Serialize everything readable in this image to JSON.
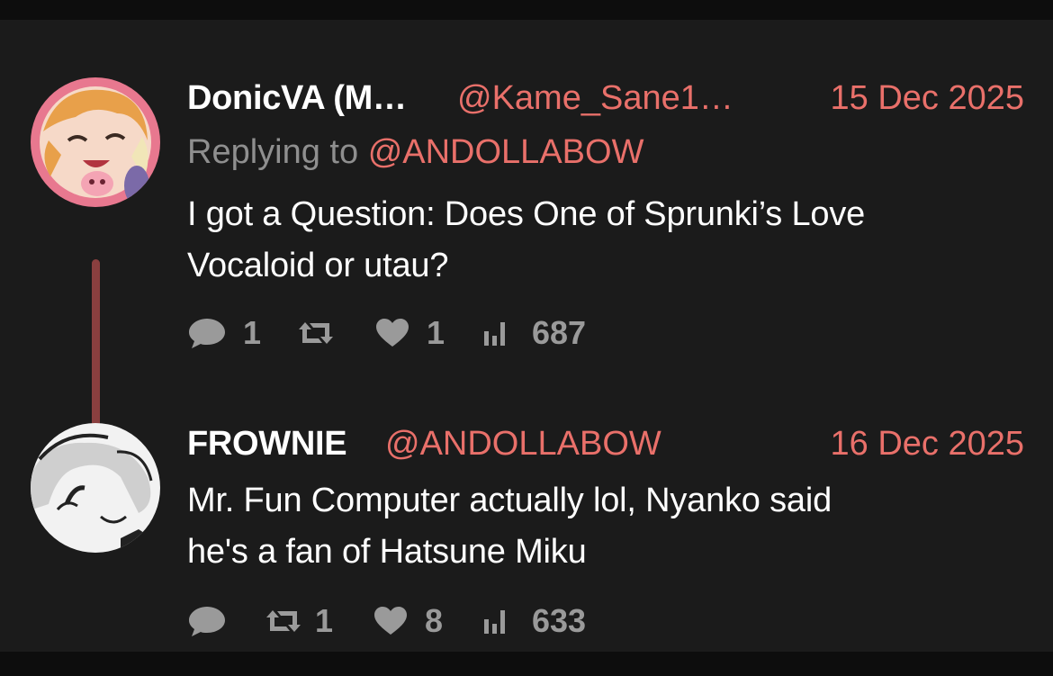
{
  "tweets": [
    {
      "name": "DonicVA (M…",
      "handle": "@Kame_Sane1…",
      "date": "15 Dec 2025",
      "replying_label": "Replying to",
      "replying_handle": "@ANDOLLABOW",
      "text_lines": [
        "I got a Question: Does One of Sprunki’s Love",
        "Vocaloid or utau?"
      ],
      "actions": {
        "replies": "1",
        "retweets": "",
        "likes": "1",
        "views": "687"
      },
      "avatar_icon": "anime-character-avatar"
    },
    {
      "name": "FROWNIE",
      "handle": "@ANDOLLABOW",
      "date": "16 Dec 2025",
      "text_lines": [
        "Mr. Fun Computer actually lol, Nyanko said",
        "he's a fan of Hatsune Miku"
      ],
      "actions": {
        "replies": "",
        "retweets": "1",
        "likes": "8",
        "views": "633"
      },
      "avatar_icon": "sketch-character-avatar"
    }
  ],
  "icons": {
    "reply": "reply-bubble-icon",
    "retweet": "retweet-icon",
    "like": "heart-icon",
    "views": "bar-chart-icon"
  },
  "colors": {
    "background": "#1b1b1b",
    "accent": "#e9706a",
    "muted": "#8f8f8f",
    "thread_line": "#8a3f3f"
  }
}
